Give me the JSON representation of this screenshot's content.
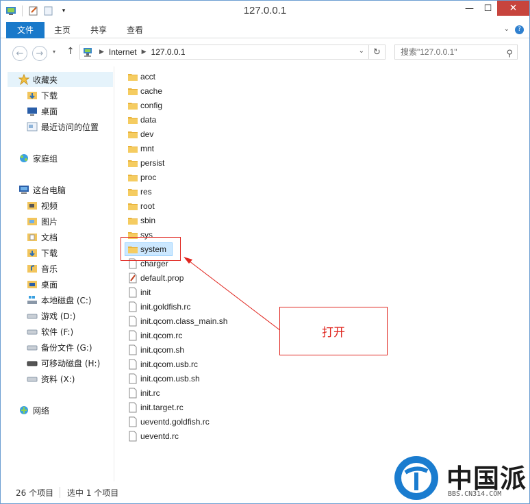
{
  "window": {
    "title": "127.0.0.1"
  },
  "ribbon": {
    "tabs": [
      "文件",
      "主页",
      "共享",
      "查看"
    ]
  },
  "address": {
    "segments": [
      "Internet",
      "127.0.0.1"
    ]
  },
  "search": {
    "placeholder": "搜索\"127.0.0.1\""
  },
  "sidebar": {
    "favorites": {
      "label": "收藏夹",
      "items": [
        "下载",
        "桌面",
        "最近访问的位置"
      ]
    },
    "homegroup": {
      "label": "家庭组"
    },
    "thispc": {
      "label": "这台电脑",
      "items": [
        "视频",
        "图片",
        "文档",
        "下载",
        "音乐",
        "桌面",
        "本地磁盘 (C:)",
        "游戏 (D:)",
        "软件 (F:)",
        "备份文件 (G:)",
        "可移动磁盘 (H:)",
        "资料 (X:)"
      ]
    },
    "network": {
      "label": "网络"
    }
  },
  "files": {
    "folders": [
      "acct",
      "cache",
      "config",
      "data",
      "dev",
      "mnt",
      "persist",
      "proc",
      "res",
      "root",
      "sbin",
      "sys",
      "system"
    ],
    "documents": [
      "charger",
      "default.prop",
      "init",
      "init.goldfish.rc",
      "init.qcom.class_main.sh",
      "init.qcom.rc",
      "init.qcom.sh",
      "init.qcom.usb.rc",
      "init.qcom.usb.sh",
      "init.rc",
      "init.target.rc",
      "ueventd.goldfish.rc",
      "ueventd.rc"
    ],
    "selected": "system"
  },
  "status": {
    "count": "26 个项目",
    "selection": "选中 1 个项目"
  },
  "annotation": {
    "callout": "打开"
  },
  "watermark": {
    "brand": "中国派",
    "url": "BBS.CN314.COM"
  },
  "colors": {
    "accent": "#1979ca",
    "annotation": "#e0261f",
    "selection": "#cce8ff"
  }
}
